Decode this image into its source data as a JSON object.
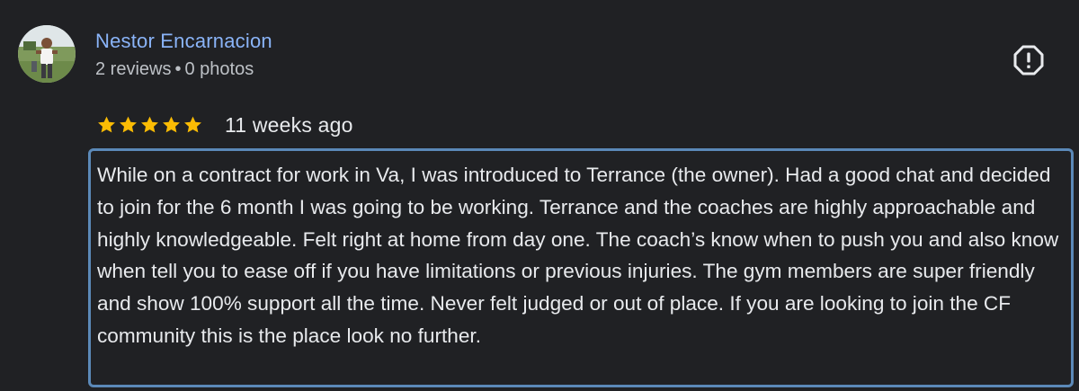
{
  "review": {
    "author": {
      "name": "Nestor Encarnacion",
      "reviews_count": "2 reviews",
      "separator": "•",
      "photos_count": "0 photos",
      "avatar_icon": "user-photo-avatar"
    },
    "report_icon": "report-flag-icon",
    "rating": {
      "stars": 5,
      "max_stars": 5,
      "star_color": "#fbbc04",
      "time_ago": "11 weeks ago"
    },
    "text": "While on a contract for work in Va, I was introduced to Terrance (the owner). Had a good chat and decided to join for the 6 month I was going to be working. Terrance and the coaches are highly approachable and highly knowledgeable. Felt right at home from day one. The coach’s know when to push you and also know when tell you to ease off if you have limitations or previous injuries. The gym members are super friendly and show 100% support all the time. Never felt judged or out of place. If you are looking to join the CF community this is the place look no further."
  },
  "colors": {
    "background": "#202124",
    "author_link": "#8ab4f8",
    "secondary_text": "#bdc1c6",
    "primary_text": "#e8eaed",
    "highlight_border": "#5b89b8"
  }
}
